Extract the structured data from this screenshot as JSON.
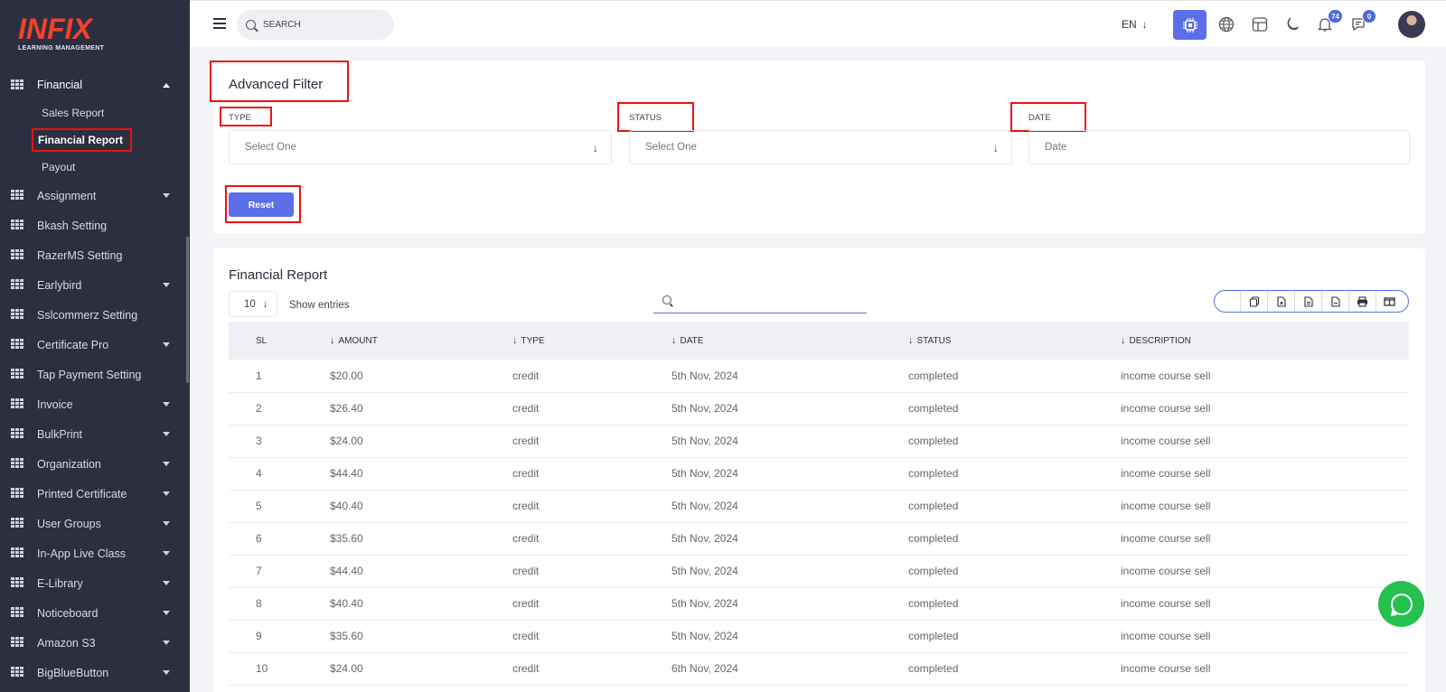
{
  "brand": {
    "name": "INFIX",
    "tagline": "LEARNING MANAGEMENT"
  },
  "sidebar": {
    "active_section": "Financial",
    "sub_items": [
      "Sales Report",
      "Financial Report",
      "Payout"
    ],
    "items": [
      {
        "label": "Assignment",
        "has_caret": true
      },
      {
        "label": "Bkash Setting",
        "has_caret": false
      },
      {
        "label": "RazerMS Setting",
        "has_caret": false
      },
      {
        "label": "Earlybird",
        "has_caret": true
      },
      {
        "label": "Sslcommerz Setting",
        "has_caret": false
      },
      {
        "label": "Certificate Pro",
        "has_caret": true
      },
      {
        "label": "Tap Payment Setting",
        "has_caret": false
      },
      {
        "label": "Invoice",
        "has_caret": true
      },
      {
        "label": "BulkPrint",
        "has_caret": true
      },
      {
        "label": "Organization",
        "has_caret": true
      },
      {
        "label": "Printed Certificate",
        "has_caret": true
      },
      {
        "label": "User Groups",
        "has_caret": true
      },
      {
        "label": "In-App Live Class",
        "has_caret": true
      },
      {
        "label": "E-Library",
        "has_caret": true
      },
      {
        "label": "Noticeboard",
        "has_caret": true
      },
      {
        "label": "Amazon S3",
        "has_caret": true
      },
      {
        "label": "BigBlueButton",
        "has_caret": true
      }
    ]
  },
  "header": {
    "search_placeholder": "SEARCH",
    "language": "EN",
    "notifications_count": "74",
    "messages_count": "0",
    "icons": [
      "menu-icon",
      "chip-icon",
      "globe-icon",
      "layout-icon",
      "moon-icon",
      "bell-icon",
      "chat-icon"
    ]
  },
  "filter": {
    "title": "Advanced Filter",
    "type_label": "TYPE",
    "type_value": "Select One",
    "status_label": "STATUS",
    "status_value": "Select One",
    "date_label": "DATE",
    "date_placeholder": "Date",
    "reset_label": "Reset"
  },
  "report": {
    "title": "Financial Report",
    "page_size": "10",
    "show_entries": "Show entries",
    "export_icons": [
      "copy-icon",
      "excel-icon",
      "csv-icon",
      "pdf-icon",
      "print-icon",
      "columns-icon"
    ],
    "columns": [
      "SL",
      "AMOUNT",
      "TYPE",
      "DATE",
      "STATUS",
      "DESCRIPTION"
    ],
    "rows": [
      [
        "1",
        "$20.00",
        "credit",
        "5th Nov, 2024",
        "completed",
        "income course sell"
      ],
      [
        "2",
        "$26.40",
        "credit",
        "5th Nov, 2024",
        "completed",
        "income course sell"
      ],
      [
        "3",
        "$24.00",
        "credit",
        "5th Nov, 2024",
        "completed",
        "income course sell"
      ],
      [
        "4",
        "$44.40",
        "credit",
        "5th Nov, 2024",
        "completed",
        "income course sell"
      ],
      [
        "5",
        "$40.40",
        "credit",
        "5th Nov, 2024",
        "completed",
        "income course sell"
      ],
      [
        "6",
        "$35.60",
        "credit",
        "5th Nov, 2024",
        "completed",
        "income course sell"
      ],
      [
        "7",
        "$44.40",
        "credit",
        "5th Nov, 2024",
        "completed",
        "income course sell"
      ],
      [
        "8",
        "$40.40",
        "credit",
        "5th Nov, 2024",
        "completed",
        "income course sell"
      ],
      [
        "9",
        "$35.60",
        "credit",
        "5th Nov, 2024",
        "completed",
        "income course sell"
      ],
      [
        "10",
        "$24.00",
        "credit",
        "6th Nov, 2024",
        "completed",
        "income course sell"
      ]
    ]
  },
  "colors": {
    "sidebar_bg": "#2c2f3f",
    "accent": "#5a6fe8",
    "highlight": "#ee1111",
    "whatsapp": "#24c14f"
  }
}
